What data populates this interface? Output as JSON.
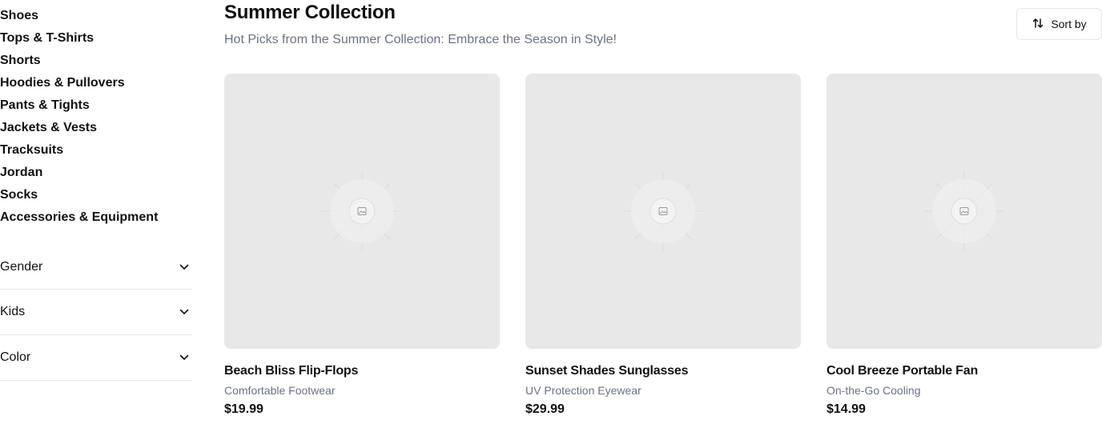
{
  "sidebar": {
    "categories": [
      "Shoes",
      "Tops & T-Shirts",
      "Shorts",
      "Hoodies & Pullovers",
      "Pants & Tights",
      "Jackets & Vests",
      "Tracksuits",
      "Jordan",
      "Socks",
      "Accessories & Equipment"
    ],
    "filters": [
      "Gender",
      "Kids",
      "Color"
    ]
  },
  "header": {
    "title": "Summer Collection",
    "subtitle": "Hot Picks from the Summer Collection: Embrace the Season in Style!",
    "sort_label": "Sort by"
  },
  "products": [
    {
      "name": "Beach Bliss Flip-Flops",
      "category": "Comfortable Footwear",
      "price": "$19.99"
    },
    {
      "name": "Sunset Shades Sunglasses",
      "category": "UV Protection Eyewear",
      "price": "$29.99"
    },
    {
      "name": "Cool Breeze Portable Fan",
      "category": "On-the-Go Cooling",
      "price": "$14.99"
    }
  ],
  "icons": {
    "sort": "sort-arrows-icon",
    "chevron": "chevron-down-icon",
    "placeholder": "image-placeholder-icon"
  }
}
